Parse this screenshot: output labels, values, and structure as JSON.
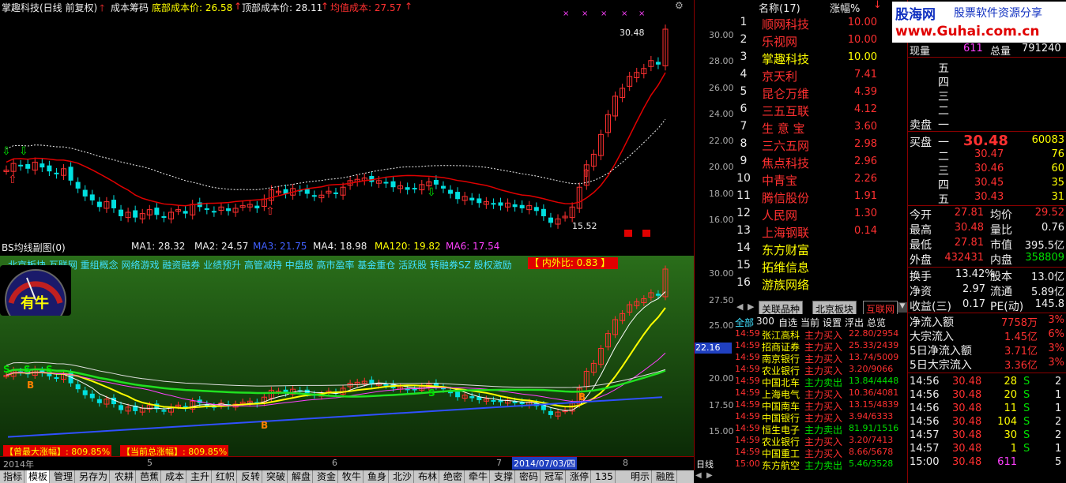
{
  "main_chart": {
    "stock_title": "掌趣科技(日线 前复权)",
    "chip_label": "成本筹码",
    "bottom_cost": "底部成本价: 26.58",
    "top_cost": "顶部成本价: 28.11",
    "avg_cost": "均值成本: 27.57",
    "high_label": "30.48",
    "low_label": "15.52",
    "y_ticks": [
      "30.00",
      "28.00",
      "26.00",
      "24.00",
      "22.00",
      "20.00",
      "18.00",
      "16.00"
    ]
  },
  "sub_chart": {
    "title": "BS均线副图(0)",
    "ma1": "MA1: 28.32",
    "ma2": "MA2: 24.57",
    "ma3": "MA3: 21.75",
    "ma4": "MA4: 18.98",
    "ma120": "MA120: 19.82",
    "ma6": "MA6: 17.54",
    "concepts": "北京板块 互联网 重组概念 网络游戏 融资融券 业绩预升 高管减持 中盘股 高市盈率 基金重仓 活跃股 转融券SZ 股权激励",
    "inner_outer": "【 内外比: 0.83 】",
    "gauge_text": "有牛",
    "max_rise": "【曾最大涨幅】: 809.85%",
    "total_rise": "【当前总涨幅】: 809.85%",
    "y_ticks": [
      "30.00",
      "27.50",
      "25.00",
      "22.16",
      "20.00",
      "17.50",
      "15.00"
    ],
    "cursor_price": "22.16"
  },
  "time_axis": {
    "labels": [
      "2014年",
      "5",
      "6",
      "7",
      "8"
    ],
    "date_highlight": "2014/07/03/四",
    "period": "日线"
  },
  "top_list": {
    "header_name": "名称(17)",
    "header_pct": "涨幅%",
    "items": [
      {
        "rank": "1",
        "name": "顺网科技",
        "pct": "10.00",
        "color": "#ff3030"
      },
      {
        "rank": "2",
        "name": "乐视网",
        "pct": "10.00",
        "color": "#ff3030"
      },
      {
        "rank": "3",
        "name": "掌趣科技",
        "pct": "10.00",
        "color": "#ffff00"
      },
      {
        "rank": "4",
        "name": "京天利",
        "pct": "7.41",
        "color": "#ff3030"
      },
      {
        "rank": "5",
        "name": "昆仑万维",
        "pct": "4.39",
        "color": "#ff3030"
      },
      {
        "rank": "6",
        "name": "三五互联",
        "pct": "4.12",
        "color": "#ff3030"
      },
      {
        "rank": "7",
        "name": "生 意 宝",
        "pct": "3.60",
        "color": "#ff3030"
      },
      {
        "rank": "8",
        "name": "三六五网",
        "pct": "2.98",
        "color": "#ff3030"
      },
      {
        "rank": "9",
        "name": "焦点科技",
        "pct": "2.96",
        "color": "#ff3030"
      },
      {
        "rank": "10",
        "name": "中青宝",
        "pct": "2.26",
        "color": "#ff3030"
      },
      {
        "rank": "11",
        "name": "腾信股份",
        "pct": "1.91",
        "color": "#ff3030"
      },
      {
        "rank": "12",
        "name": "人民网",
        "pct": "1.30",
        "color": "#ff3030"
      },
      {
        "rank": "13",
        "name": "上海钢联",
        "pct": "0.14",
        "color": "#ff3030"
      },
      {
        "rank": "14",
        "name": "东方财富",
        "pct": "",
        "color": "#ffff00"
      },
      {
        "rank": "15",
        "name": "拓维信息",
        "pct": "",
        "color": "#ffff00"
      },
      {
        "rank": "16",
        "name": "游族网络",
        "pct": "",
        "color": "#ffff00"
      }
    ]
  },
  "list_tabs": [
    "关联品种",
    "北京板块",
    "互联网"
  ],
  "sub_tabs": [
    "全部",
    "300",
    "自选",
    "当前",
    "设置",
    "浮出",
    "总览"
  ],
  "trades": [
    {
      "time": "14:59",
      "name": "张江高科",
      "type": "主力买入",
      "val": "22.80/2954",
      "tc": "#ff3030"
    },
    {
      "time": "14:59",
      "name": "招商证券",
      "type": "主力买入",
      "val": "25.33/2439",
      "tc": "#ff3030"
    },
    {
      "time": "14:59",
      "name": "南京银行",
      "type": "主力买入",
      "val": "13.74/5009",
      "tc": "#ff3030"
    },
    {
      "time": "14:59",
      "name": "农业银行",
      "type": "主力买入",
      "val": "3.20/9066",
      "tc": "#ff3030"
    },
    {
      "time": "14:59",
      "name": "中国北车",
      "type": "主力卖出",
      "val": "13.84/4448",
      "tc": "#00e000"
    },
    {
      "time": "14:59",
      "name": "上海电气",
      "type": "主力买入",
      "val": "10.36/4081",
      "tc": "#ff3030"
    },
    {
      "time": "14:59",
      "name": "中国南车",
      "type": "主力买入",
      "val": "13.15/4839",
      "tc": "#ff3030"
    },
    {
      "time": "14:59",
      "name": "中国银行",
      "type": "主力买入",
      "val": "3.94/6333",
      "tc": "#ff3030"
    },
    {
      "time": "14:59",
      "name": "恒生电子",
      "type": "主力卖出",
      "val": "81.91/1516",
      "tc": "#00e000"
    },
    {
      "time": "14:59",
      "name": "农业银行",
      "type": "主力买入",
      "val": "3.20/7413",
      "tc": "#ff3030"
    },
    {
      "time": "14:59",
      "name": "中国重工",
      "type": "主力买入",
      "val": "8.66/5678",
      "tc": "#ff3030"
    },
    {
      "time": "15:00",
      "name": "东方航空",
      "type": "主力卖出",
      "val": "5.46/3528",
      "tc": "#00e000"
    }
  ],
  "logo": {
    "brand": "股海网",
    "slogan": "股票软件资源分享",
    "url": "www.Guhai.com.cn"
  },
  "quote": {
    "xianliang_label": "现量",
    "xianliang": "611",
    "zongliang_label": "总量",
    "zongliang": "791240",
    "ask_label": "卖盘",
    "asks": [
      {
        "lvl": "五",
        "p": "",
        "v": ""
      },
      {
        "lvl": "四",
        "p": "",
        "v": ""
      },
      {
        "lvl": "三",
        "p": "",
        "v": ""
      },
      {
        "lvl": "二",
        "p": "",
        "v": ""
      },
      {
        "lvl": "一",
        "p": "",
        "v": ""
      }
    ],
    "bid_label": "买盘",
    "bids": [
      {
        "lvl": "一",
        "p": "30.48",
        "v": "60083"
      },
      {
        "lvl": "二",
        "p": "30.47",
        "v": "76"
      },
      {
        "lvl": "三",
        "p": "30.46",
        "v": "60"
      },
      {
        "lvl": "四",
        "p": "30.45",
        "v": "35"
      },
      {
        "lvl": "五",
        "p": "30.43",
        "v": "31"
      }
    ],
    "stats": [
      {
        "l1": "今开",
        "v1": "27.81",
        "l2": "均价",
        "v2": "29.52"
      },
      {
        "l1": "最高",
        "v1": "30.48",
        "l2": "量比",
        "v2": "0.76"
      },
      {
        "l1": "最低",
        "v1": "27.81",
        "l2": "市值",
        "v2": "395.5亿"
      },
      {
        "l1": "外盘",
        "v1": "432431",
        "l2": "内盘",
        "v2": "358809"
      }
    ],
    "stats2": [
      {
        "l1": "换手",
        "v1": "13.42%",
        "l2": "股本",
        "v2": "13.0亿"
      },
      {
        "l1": "净资",
        "v1": "2.97",
        "l2": "流通",
        "v2": "5.89亿"
      },
      {
        "l1": "收益(三)",
        "v1": "0.17",
        "l2": "PE(动)",
        "v2": "145.8"
      }
    ],
    "flows": [
      {
        "l": "净流入额",
        "v": "7758万",
        "p": "3%"
      },
      {
        "l": "大宗流入",
        "v": "1.45亿",
        "p": "6%"
      },
      {
        "l": "5日净流入额",
        "v": "3.71亿",
        "p": "3%"
      },
      {
        "l": "5日大宗流入",
        "v": "3.36亿",
        "p": "3%"
      }
    ],
    "ticks": [
      {
        "t": "14:56",
        "p": "30.48",
        "v": "28",
        "s": "S",
        "n": "2"
      },
      {
        "t": "14:56",
        "p": "30.48",
        "v": "20",
        "s": "S",
        "n": "1"
      },
      {
        "t": "14:56",
        "p": "30.48",
        "v": "11",
        "s": "S",
        "n": "1"
      },
      {
        "t": "14:56",
        "p": "30.48",
        "v": "104",
        "s": "S",
        "n": "2"
      },
      {
        "t": "14:57",
        "p": "30.48",
        "v": "30",
        "s": "S",
        "n": "2"
      },
      {
        "t": "14:57",
        "p": "30.48",
        "v": "1",
        "s": "S",
        "n": "1"
      },
      {
        "t": "15:00",
        "p": "30.48",
        "v": "611",
        "s": "",
        "n": "5"
      }
    ]
  },
  "bottom_tabs": [
    "指标",
    "模板",
    "管理",
    "另存为",
    "农耕",
    "芭蕉",
    "成本",
    "主升",
    "红帜",
    "反转",
    "突破",
    "解盘",
    "资金",
    "牧牛",
    "鱼身",
    "北沙",
    "布林",
    "绝密",
    "牵牛",
    "支撑",
    "密码",
    "冠军",
    "涨停",
    "135",
    "明示",
    "融胜"
  ],
  "colors": {
    "up": "#ff3030",
    "down": "#00e0e0",
    "accent": "#ffff00"
  }
}
